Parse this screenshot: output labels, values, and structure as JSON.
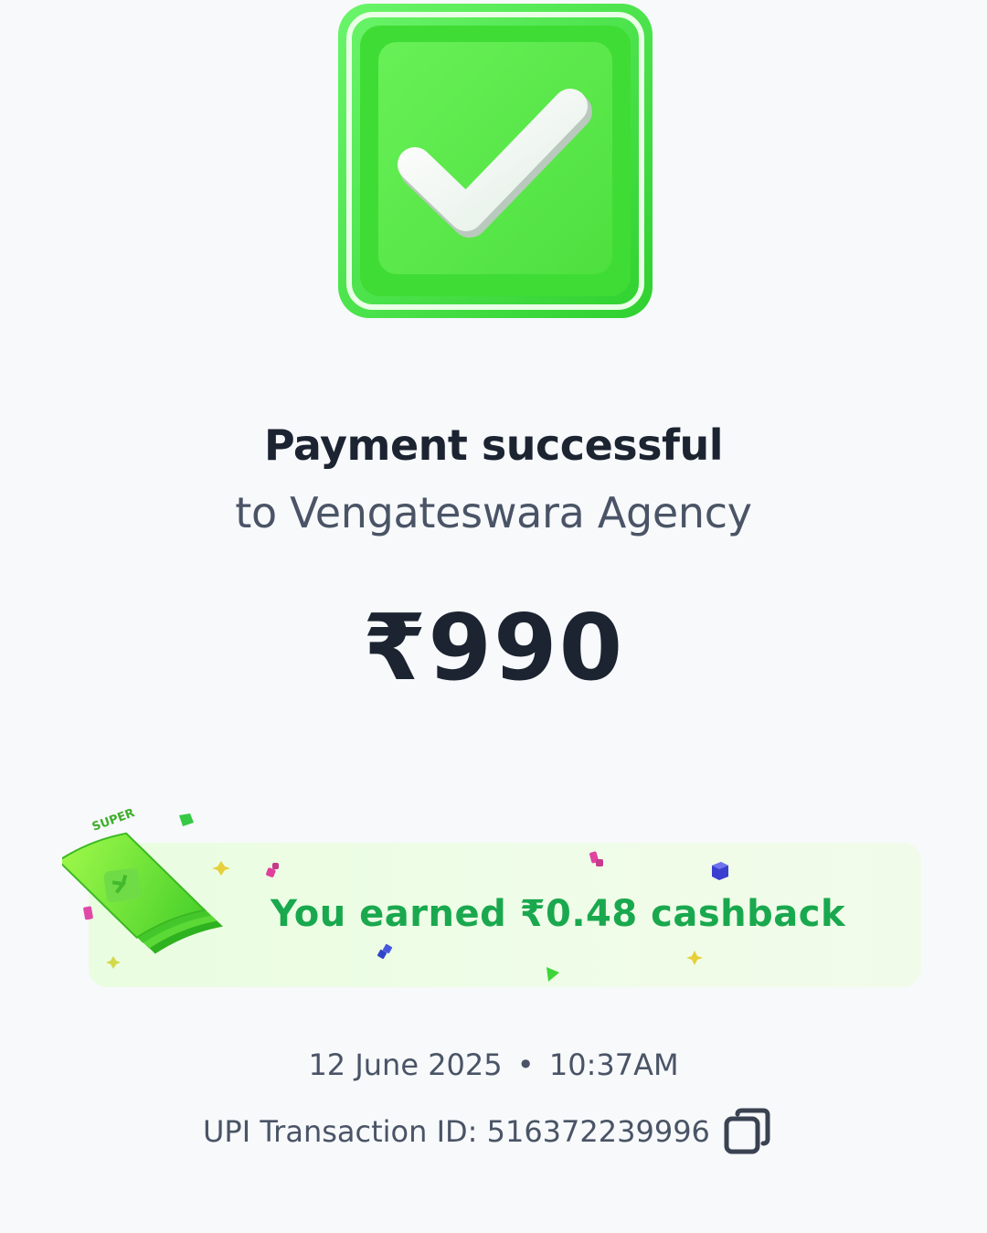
{
  "header": {
    "title": "Payment successful",
    "recipient": "to Vengateswara Agency"
  },
  "payment": {
    "amount": "₹990"
  },
  "cashback": {
    "text": "You earned ₹0.48 cashback",
    "badge_label": "SUPER"
  },
  "meta": {
    "date": "12 June 2025",
    "separator": "•",
    "time": "10:37AM",
    "transaction_label": "UPI Transaction ID: 516372239996"
  },
  "icons": {
    "status": "check-icon",
    "copy": "copy-icon",
    "cashback_illustration": "money-stack-icon"
  },
  "colors": {
    "success_green": "#4fe543",
    "cashback_green": "#1aa84e",
    "text_dark": "#1c2331",
    "text_muted": "#4a5466"
  }
}
